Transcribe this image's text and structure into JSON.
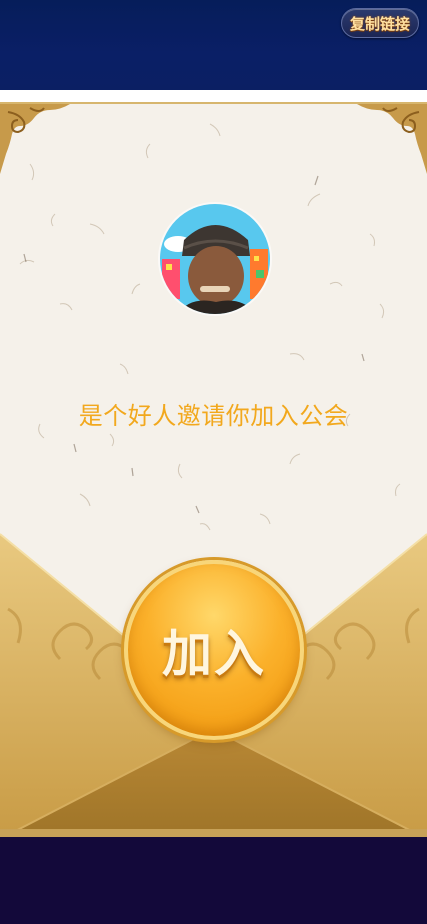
{
  "header": {
    "copy_link_label": "复制链接"
  },
  "invite": {
    "message": "是个好人邀请你加入公会",
    "join_label": "加入"
  },
  "colors": {
    "header_bg": "#0a1f66",
    "paper_bg": "#f5f1ea",
    "accent_gold": "#f2a81d",
    "footer_bg": "#13093a"
  },
  "icons": {
    "avatar": "user-avatar",
    "corner": "ornament-corner"
  }
}
